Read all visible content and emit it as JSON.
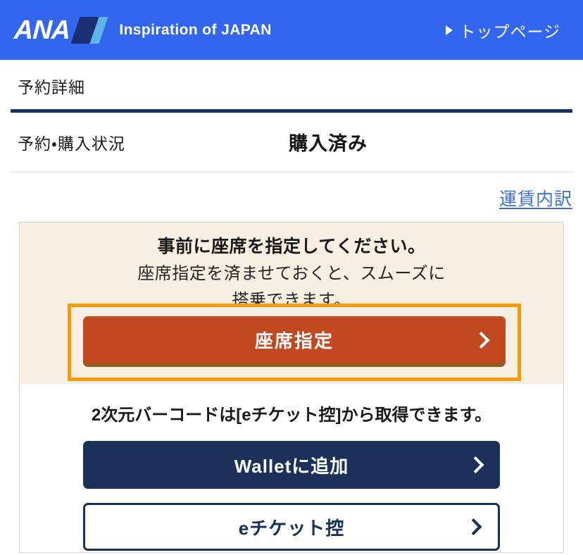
{
  "header": {
    "brand_word": "ANA",
    "brand_mark": "ana-parallelogram-logo",
    "tagline": "Inspiration of JAPAN",
    "top_link": "トップページ",
    "background_color": "#3366ee"
  },
  "page": {
    "title": "予約詳細",
    "rule_color": "#14305c"
  },
  "status": {
    "label": "予約・購入状況",
    "value": "購入済み"
  },
  "fare": {
    "link_label": "運賃内訳",
    "link_color": "#3a6fd8"
  },
  "promo": {
    "heading": "事前に座席を指定してください。",
    "sub_line_1": "座席指定を済ませておくと、スムーズに",
    "sub_line_2": "搭乗できます。",
    "background_color": "#f7efe2",
    "focus_ring_color": "#f59a0b",
    "seat_button": {
      "label": "座席指定",
      "background_color": "#c2491f",
      "shadow_color": "#8a5f23",
      "chevron": "chevron-right-icon"
    }
  },
  "ticket": {
    "barcode_note": "2次元バーコードは[eチケット控]から取得できます。",
    "wallet_button": {
      "label": "Walletに追加",
      "background_color": "#1b3159",
      "chevron": "chevron-right-icon"
    },
    "eticket_button": {
      "label": "eチケット控",
      "border_color": "#14305c",
      "text_color": "#14305c",
      "chevron": "chevron-right-icon"
    }
  }
}
